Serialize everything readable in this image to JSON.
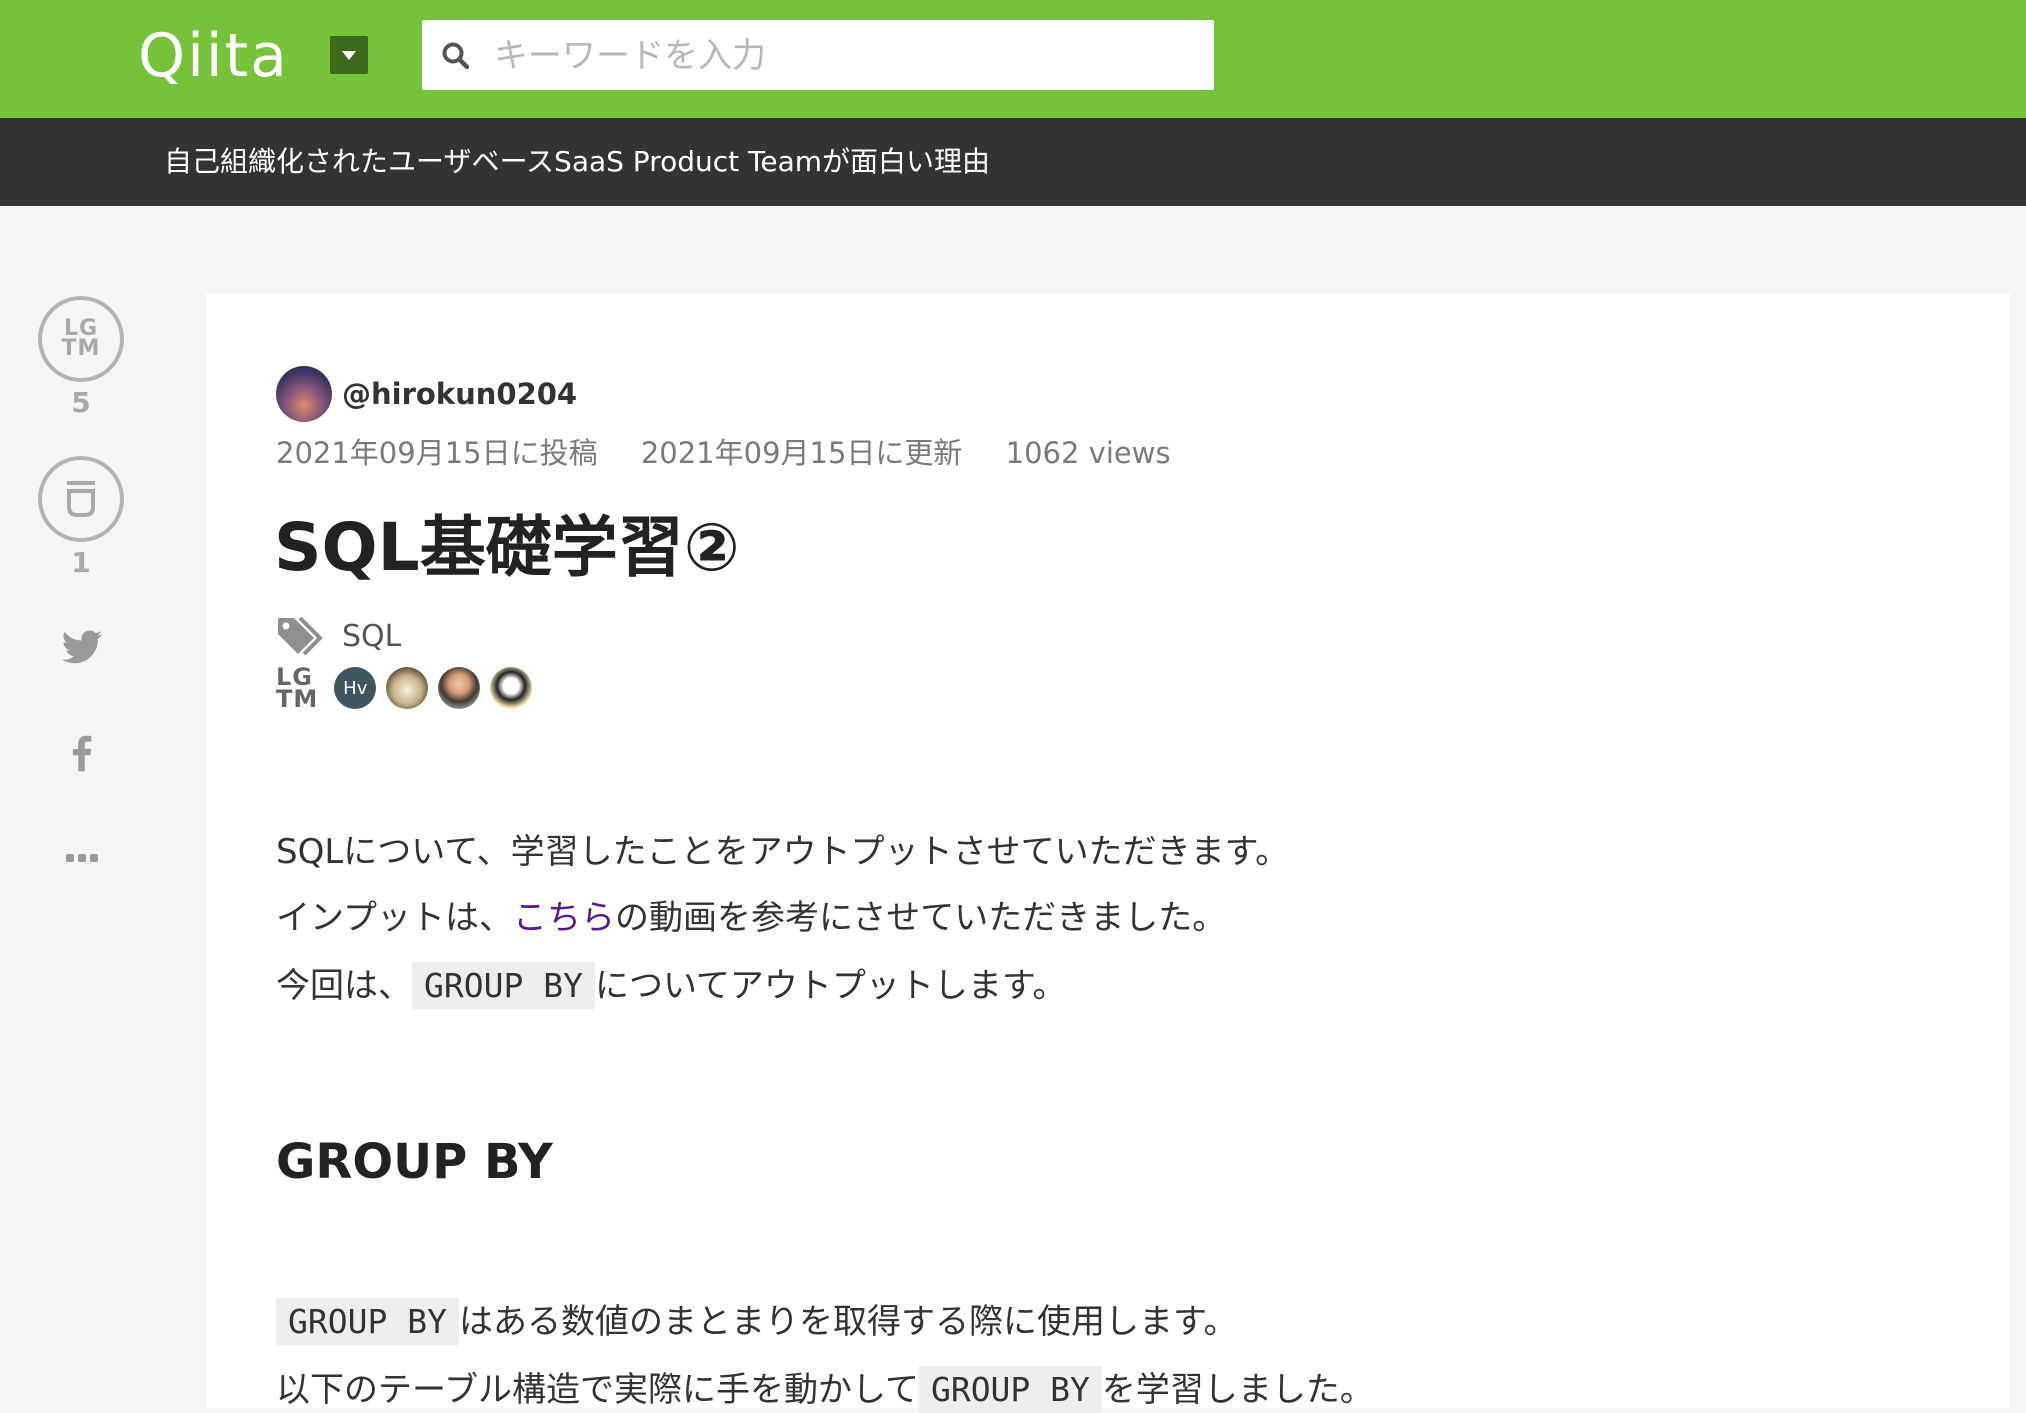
{
  "header": {
    "logo": "Qiita",
    "search_placeholder": "キーワードを入力",
    "search_value": ""
  },
  "org_bar": {
    "title": "自己組織化されたユーザベースSaaS Product Teamが面白い理由"
  },
  "rail": {
    "lgtm_line1": "LG",
    "lgtm_line2": "TM",
    "lgtm_count": "5",
    "stock_count": "1"
  },
  "article": {
    "author": "@hirokun0204",
    "posted": "2021年09月15日に投稿",
    "updated": "2021年09月15日に更新",
    "views": "1062 views",
    "title": "SQL基礎学習②",
    "tags": [
      "SQL"
    ],
    "likers_label_line1": "LG",
    "likers_label_line2": "TM",
    "likers": [
      {
        "initials": "Hv"
      },
      {
        "initials": ""
      },
      {
        "initials": ""
      },
      {
        "initials": ""
      }
    ],
    "p1": "SQLについて、学習したことをアウトプットさせていただきます。",
    "p2_before": "インプットは、",
    "p2_link": "こちら",
    "p2_after": "の動画を参考にさせていただきました。",
    "p3_before": "今回は、",
    "p3_code": "GROUP BY",
    "p3_after": "についてアウトプットします。",
    "h2": "GROUP BY",
    "p4_code": "GROUP BY",
    "p4_after": "はある数値のまとまりを取得する際に使用します。",
    "p5_before": "以下のテーブル構造で実際に手を動かして",
    "p5_code": "GROUP BY",
    "p5_after": "を学習しました。"
  },
  "colors": {
    "header_green": "#76c23b",
    "org_bar": "#333333",
    "link": "#551a8b"
  }
}
